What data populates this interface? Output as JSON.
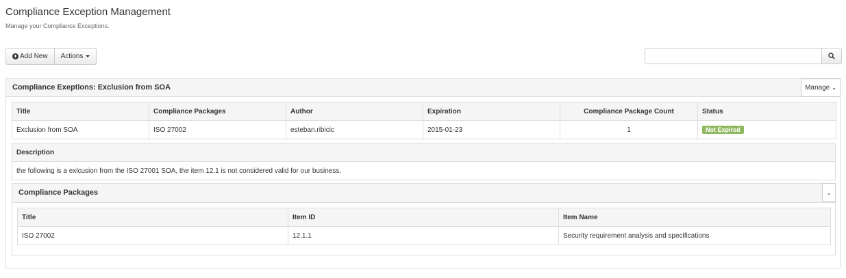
{
  "header": {
    "title": "Compliance Exception Management",
    "subtitle": "Manage your Compliance Exceptions."
  },
  "toolbar": {
    "add_label": "Add New",
    "actions_label": "Actions"
  },
  "search": {
    "value": "",
    "placeholder": ""
  },
  "panel": {
    "title": "Compliance Exeptions: Exclusion from SOA",
    "manage_label": "Manage"
  },
  "exception_table": {
    "headers": [
      "Title",
      "Compliance Packages",
      "Author",
      "Expiration",
      "Compliance Package Count",
      "Status"
    ],
    "row": {
      "title": "Exclusion from SOA",
      "packages": "ISO 27002",
      "author": "esteban.ribicic",
      "expiration": "2015-01-23",
      "count": "1",
      "status": "Not Expired"
    }
  },
  "description": {
    "header": "Description",
    "text": "the following is a exlcusion from the ISO 27001 SOA, the item 12.1 is not considered valid for our business."
  },
  "packages_panel": {
    "title": "Compliance Packages",
    "headers": [
      "Title",
      "Item ID",
      "Item Name"
    ],
    "row": {
      "title": "ISO 27002",
      "item_id": "12.1.1",
      "item_name": "Security requirement analysis and specifications"
    }
  },
  "colors": {
    "status_badge": "#8fb960",
    "header_bg": "#f5f5f5",
    "border": "#dddddd"
  },
  "icons": {
    "add": "plus-circle-icon",
    "actions": "caret-down-icon",
    "search": "search-icon",
    "manage": "chevron-down-icon",
    "collapse": "chevron-down-icon"
  }
}
